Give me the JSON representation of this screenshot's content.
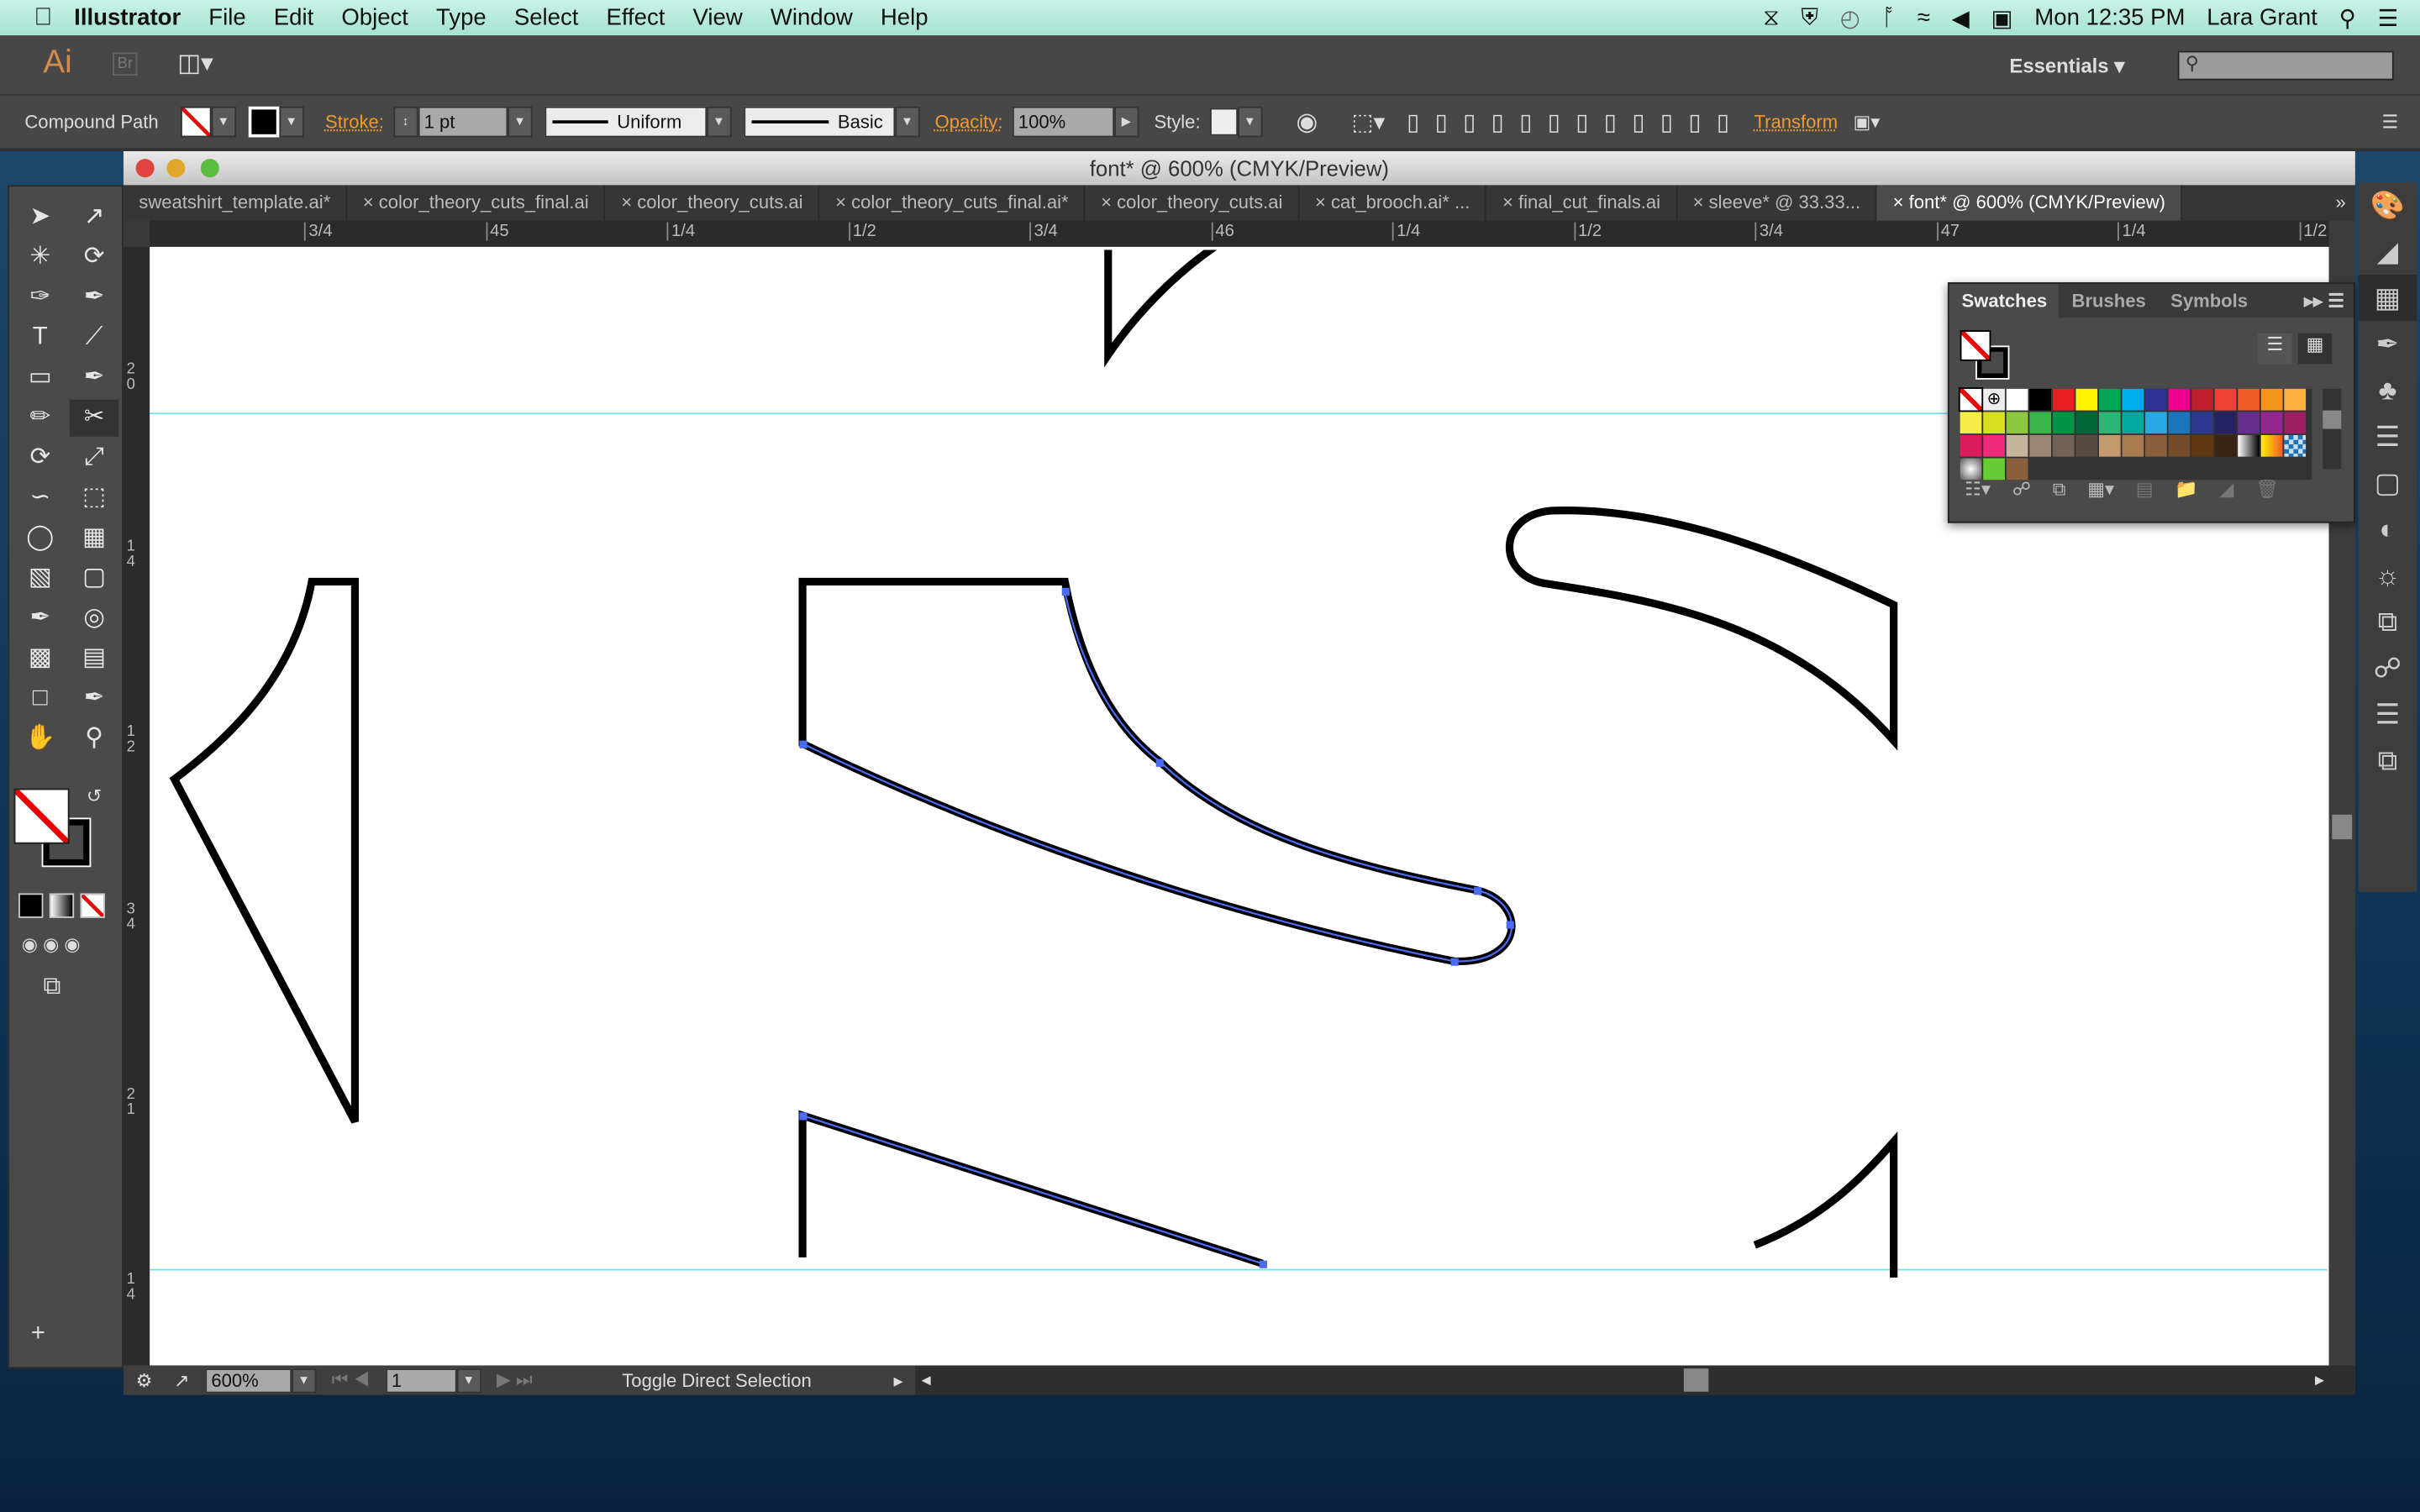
{
  "menubar": {
    "app": "Illustrator",
    "items": [
      "File",
      "Edit",
      "Object",
      "Type",
      "Select",
      "Effect",
      "View",
      "Window",
      "Help"
    ],
    "clock": "Mon 12:35 PM",
    "user": "Lara Grant"
  },
  "appbar": {
    "logo": "Ai",
    "bridge": "Br",
    "workspace": "Essentials"
  },
  "control": {
    "selection": "Compound Path",
    "stroke_label": "Stroke:",
    "stroke_weight": "1 pt",
    "profile": "Uniform",
    "brush": "Basic",
    "opacity_label": "Opacity:",
    "opacity": "100%",
    "style_label": "Style:",
    "transform": "Transform"
  },
  "document": {
    "title": "font* @ 600% (CMYK/Preview)",
    "tabs": [
      "sweatshirt_template.ai*",
      "color_theory_cuts_final.ai",
      "color_theory_cuts.ai",
      "color_theory_cuts_final.ai*",
      "color_theory_cuts.ai",
      "cat_brooch.ai* ...",
      "final_cut_finals.ai",
      "sleeve* @ 33.33...",
      "font* @ 600% (CMYK/Preview)"
    ],
    "active_tab": 8,
    "hruler": [
      "3/4",
      "45",
      "1/4",
      "1/2",
      "3/4",
      "46",
      "1/4",
      "1/2",
      "3/4",
      "47",
      "1/4",
      "1/2"
    ],
    "vruler": [
      "2 0",
      "1 4",
      "1 2",
      "3 4",
      "2 1",
      "1 4"
    ]
  },
  "status": {
    "zoom": "600%",
    "artboard": "1",
    "message": "Toggle Direct Selection"
  },
  "swatches": {
    "tabs": [
      "Swatches",
      "Brushes",
      "Symbols"
    ],
    "colors": [
      "#ffffff",
      "#000000",
      "#ed1c24",
      "#fff200",
      "#00a651",
      "#00aeef",
      "#2e3192",
      "#ec008c",
      "#be1e2d",
      "#ef4136",
      "#f15a29",
      "#f7941d",
      "#fbb040",
      "#f7ec45",
      "#d7df23",
      "#8dc63f",
      "#39b54a",
      "#009444",
      "#006838",
      "#2bb673",
      "#00a99d",
      "#27aae1",
      "#1c75bc",
      "#2b3990",
      "#262262",
      "#662d91",
      "#92278f",
      "#9e1f63",
      "#da1c5c",
      "#ee2a7b",
      "#c2b59b",
      "#998675",
      "#736357",
      "#594a42",
      "#c49a6c",
      "#a97c50",
      "#8b5e3c",
      "#754c29",
      "#603913",
      "#3c2415"
    ]
  },
  "colors": {
    "accent": "#f39a2b",
    "guide": "#6fe0f0",
    "path": "#4a6cf5"
  }
}
